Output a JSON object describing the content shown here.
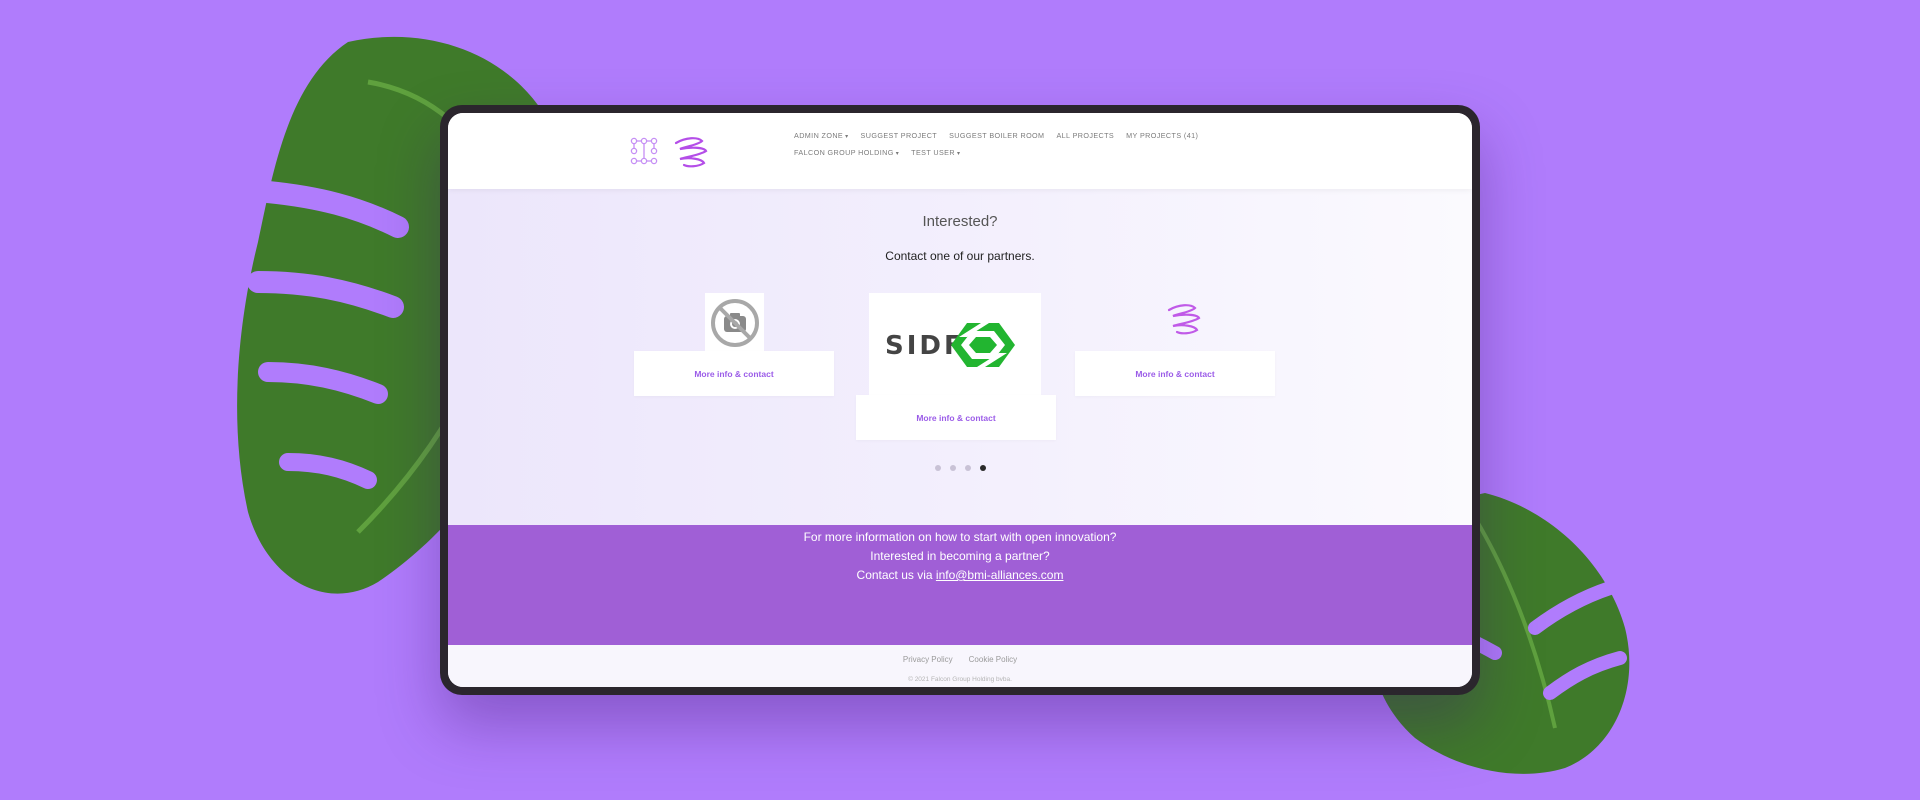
{
  "header": {
    "nav_row1": [
      {
        "label": "ADMIN ZONE",
        "has_caret": true
      },
      {
        "label": "SUGGEST PROJECT",
        "has_caret": false
      },
      {
        "label": "SUGGEST BOILER ROOM",
        "has_caret": false
      },
      {
        "label": "ALL PROJECTS",
        "has_caret": false
      },
      {
        "label": "MY PROJECTS (41)",
        "has_caret": false
      }
    ],
    "nav_row2": [
      {
        "label": "FALCON GROUP HOLDING",
        "has_caret": true
      },
      {
        "label": "TEST USER",
        "has_caret": true
      }
    ],
    "caret": "▾"
  },
  "partners": {
    "title": "Interested?",
    "subtitle": "Contact one of our partners.",
    "cards": [
      {
        "logo": "no-image-icon",
        "link": "More info & contact"
      },
      {
        "logo": "sidf-logo",
        "logo_text": "SIDF",
        "link": "More info & contact"
      },
      {
        "logo": "brand-squiggle-logo",
        "link": "More info & contact"
      }
    ],
    "carousel": {
      "count": 4,
      "active_index": 3
    }
  },
  "cta": {
    "line1": "For more information on how to start with open innovation?",
    "line2": "Interested in becoming a partner?",
    "line3_prefix": "Contact us via ",
    "email": "info@bmi-alliances.com"
  },
  "footer": {
    "privacy": "Privacy Policy",
    "cookie": "Cookie Policy",
    "copyright": "© 2021 Falcon Group Holding bvba."
  },
  "colors": {
    "background": "#b07cfc",
    "accent": "#9b5ce8",
    "cta_band": "#a05fd6",
    "sidf_green": "#22b530"
  }
}
